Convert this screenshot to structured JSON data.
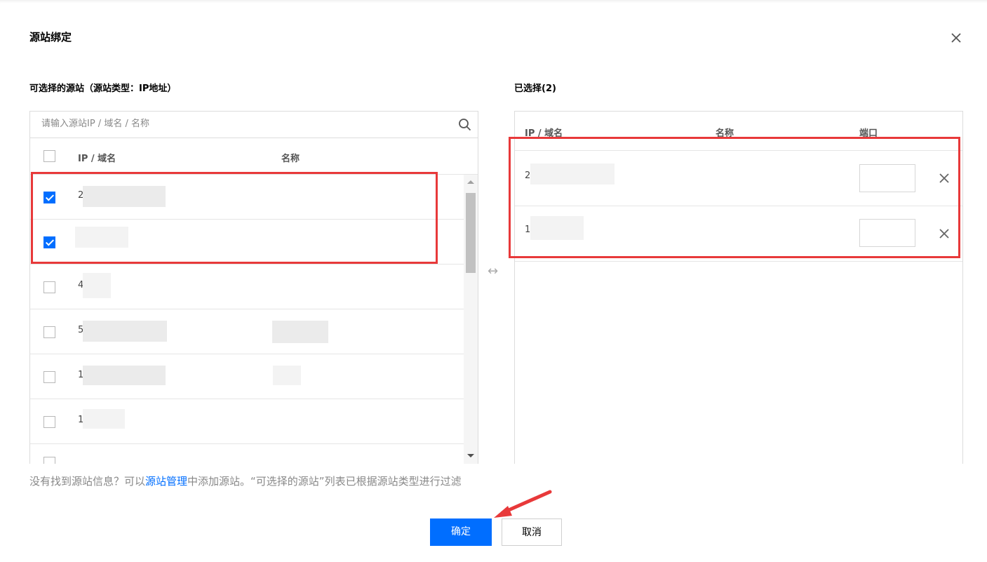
{
  "dialog": {
    "title": "源站绑定",
    "close_icon": "close-icon"
  },
  "left": {
    "label": "可选择的源站（源站类型：IP地址）",
    "search_placeholder": "请输入源站IP / 域名 / 名称",
    "columns": {
      "ip": "IP / 域名",
      "name": "名称"
    },
    "rows": [
      {
        "ip_prefix": "2",
        "checked": true
      },
      {
        "ip_prefix": "",
        "checked": true
      },
      {
        "ip_prefix": "4",
        "checked": false
      },
      {
        "ip_prefix": "5",
        "checked": false
      },
      {
        "ip_prefix": "1",
        "checked": false
      },
      {
        "ip_prefix": "1",
        "checked": false
      }
    ]
  },
  "right": {
    "label": "已选择(2)",
    "columns": {
      "ip": "IP / 域名",
      "name": "名称",
      "port": "端口"
    },
    "rows": [
      {
        "ip_prefix": "2",
        "port": ""
      },
      {
        "ip_prefix": "1",
        "port": ""
      }
    ]
  },
  "hint": {
    "prefix": "没有找到源站信息？可以",
    "link": "源站管理",
    "suffix": "中添加源站。“可选择的源站”列表已根据源站类型进行过滤"
  },
  "buttons": {
    "ok": "确定",
    "cancel": "取消"
  },
  "colors": {
    "primary": "#006eff",
    "highlight": "#e8393a"
  }
}
